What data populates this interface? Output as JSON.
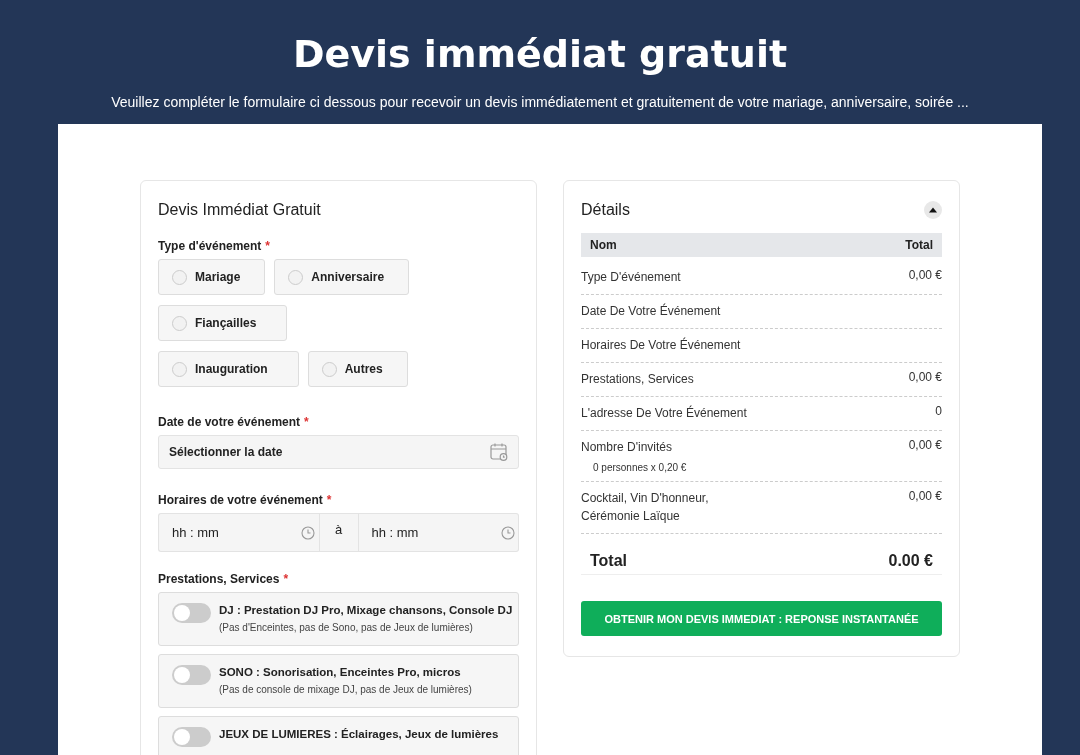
{
  "header": {
    "title": "Devis immédiat gratuit",
    "subtitle": "Veuillez compléter le formulaire ci dessous pour recevoir un devis immédiatement et gratuitement de votre mariage, anniversaire, soirée ..."
  },
  "form": {
    "title": "Devis Immédiat Gratuit",
    "event_type": {
      "label": "Type d'événement",
      "required": "*",
      "options": [
        {
          "label": "Mariage",
          "selected": false
        },
        {
          "label": "Anniversaire",
          "selected": false
        },
        {
          "label": "Fiançailles",
          "selected": false
        },
        {
          "label": "Inauguration",
          "selected": false
        },
        {
          "label": "Autres",
          "selected": false
        }
      ]
    },
    "date": {
      "label": "Date de votre événement",
      "required": "*",
      "placeholder": "Sélectionner la date"
    },
    "hours": {
      "label": "Horaires de votre événement",
      "required": "*",
      "from_placeholder": "hh : mm",
      "separator": "à",
      "to_placeholder": "hh : mm"
    },
    "services": {
      "label": "Prestations, Services",
      "required": "*",
      "items": [
        {
          "title": "DJ : Prestation DJ Pro, Mixage chansons, Console DJ",
          "note": "(Pas d'Enceintes, pas de Sono, pas de Jeux de lumières)",
          "on": false
        },
        {
          "title": "SONO : Sonorisation, Enceintes Pro, micros",
          "note": "(Pas de console de mixage DJ, pas de Jeux de lumières)",
          "on": false
        },
        {
          "title": "JEUX DE LUMIERES : Éclairages, Jeux de lumières",
          "on": false
        }
      ]
    }
  },
  "details": {
    "title": "Détails",
    "expanded": true,
    "table": {
      "columns": [
        "Nom",
        "Total"
      ],
      "rows": [
        {
          "name": "Type D'événement",
          "total": "0,00 €"
        },
        {
          "name": "Date De Votre Événement"
        },
        {
          "name": "Horaires De Votre Événement"
        },
        {
          "name": "Prestations, Services",
          "total": "0,00 €"
        },
        {
          "name": "L'adresse De Votre Événement",
          "total": "0"
        },
        {
          "name": "Nombre D'invités",
          "total": "0,00 €",
          "sub": "0 personnes x 0,20 €"
        },
        {
          "name": "Cocktail, Vin D'honneur, Cérémonie Laïque",
          "total": "0,00 €"
        }
      ]
    },
    "total_label": "Total",
    "total_value": "0.00 €",
    "submit": "OBTENIR MON DEVIS IMMEDIAT : REPONSE INSTANTANÉE"
  }
}
